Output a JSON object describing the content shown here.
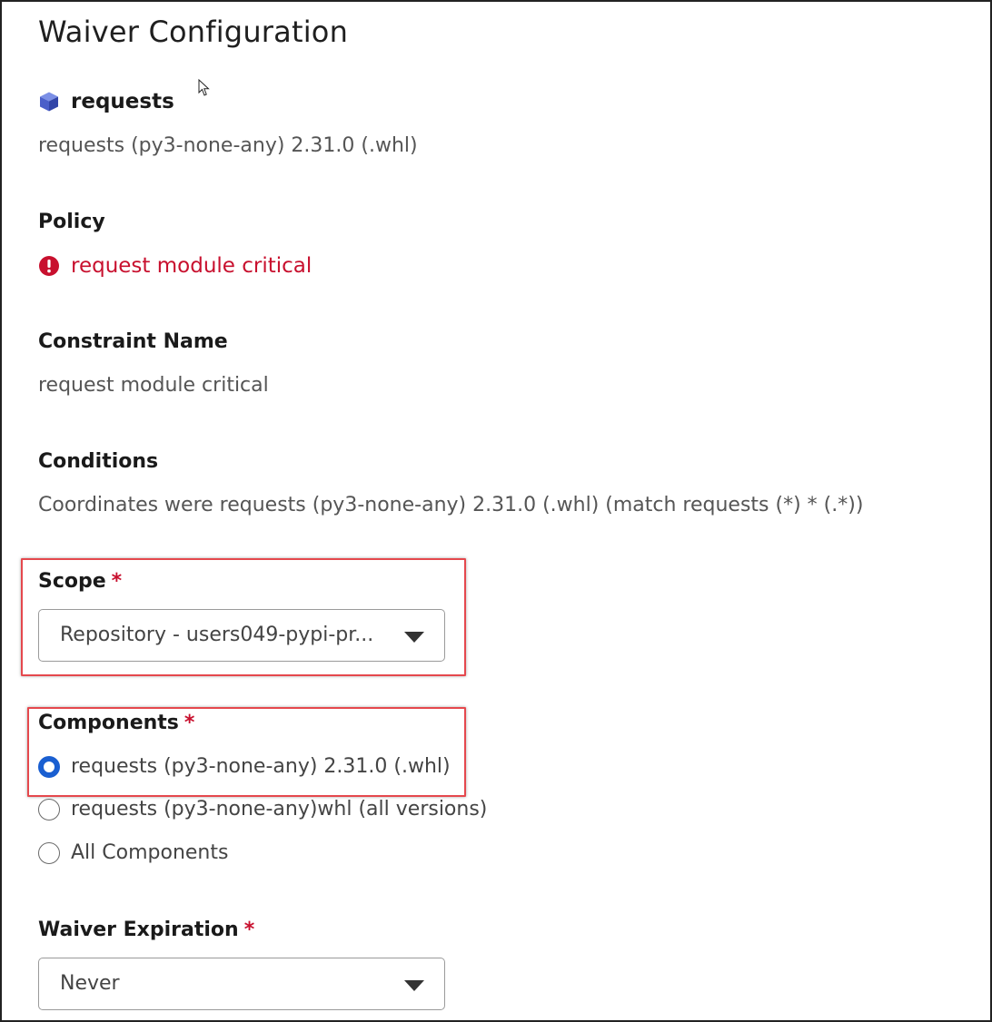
{
  "title": "Waiver Configuration",
  "component": {
    "name": "requests",
    "icon": "cube-icon",
    "coordinates": "requests (py3-none-any) 2.31.0 (.whl)"
  },
  "policy": {
    "label": "Policy",
    "name": "request module critical",
    "icon": "alert-circle-icon",
    "color": "#c8102e"
  },
  "constraint": {
    "label": "Constraint Name",
    "value": "request module critical"
  },
  "conditions": {
    "label": "Conditions",
    "value": "Coordinates were requests (py3-none-any) 2.31.0 (.whl) (match requests (*) * (.*))"
  },
  "scope": {
    "label": "Scope",
    "required_mark": "*",
    "selected": "Repository - users049-pypi-pr..."
  },
  "components": {
    "label": "Components",
    "required_mark": "*",
    "options": [
      {
        "label": "requests (py3-none-any) 2.31.0 (.whl)",
        "checked": true
      },
      {
        "label": "requests (py3-none-any)whl (all versions)",
        "checked": false
      },
      {
        "label": "All Components",
        "checked": false
      }
    ]
  },
  "expiration": {
    "label": "Waiver Expiration",
    "required_mark": "*",
    "selected": "Never"
  },
  "colors": {
    "accent": "#1a5fd1",
    "required": "#c8102e",
    "highlight": "#e5484d"
  }
}
